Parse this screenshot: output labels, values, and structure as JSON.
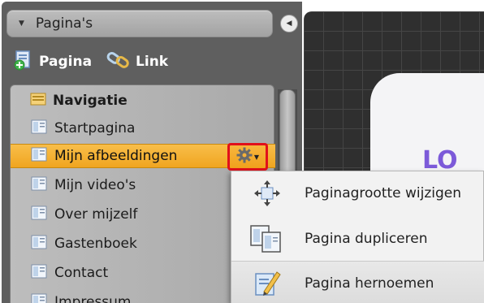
{
  "panel": {
    "title": "Pagina's",
    "add_page_label": "Pagina",
    "add_link_label": "Link"
  },
  "nav": {
    "heading": "Navigatie",
    "items": [
      {
        "label": "Startpagina"
      },
      {
        "label": "Mijn afbeeldingen",
        "selected": true
      },
      {
        "label": "Mijn video's"
      },
      {
        "label": "Over mijzelf"
      },
      {
        "label": "Gastenboek"
      },
      {
        "label": "Contact"
      },
      {
        "label": "Impressum"
      }
    ]
  },
  "context_menu": {
    "items": [
      {
        "label": "Paginagrootte wijzigen",
        "icon": "resize-icon"
      },
      {
        "label": "Pagina dupliceren",
        "icon": "duplicate-icon"
      },
      {
        "label": "Pagina hernoemen",
        "icon": "rename-icon"
      }
    ]
  },
  "canvas": {
    "logo_text": "LO"
  },
  "colors": {
    "selected_row": "#f0a520",
    "highlight_border": "#e1101b",
    "panel_bg": "#5f5f5f",
    "canvas_bg": "#2f2f2f"
  }
}
